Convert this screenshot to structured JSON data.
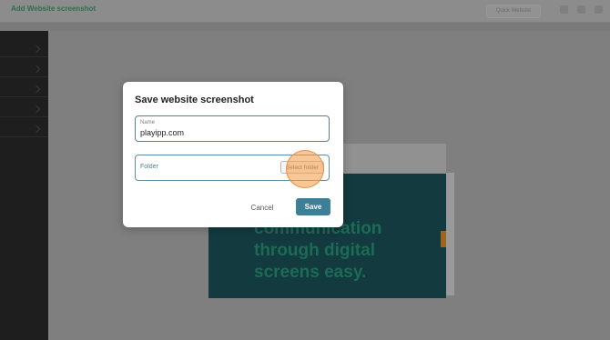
{
  "app": {
    "title": "Add Website screenshot",
    "top_button_label": "Quick Website"
  },
  "preview": {
    "headline": "...kes communication through digital screens easy."
  },
  "modal": {
    "title": "Save website screenshot",
    "name_label": "Name",
    "name_value": "playipp.com",
    "folder_label": "Folder",
    "select_folder_label": "Select folder",
    "cancel_label": "Cancel",
    "save_label": "Save"
  },
  "colors": {
    "accent": "#3d7e98",
    "click_highlight": "#f5a050",
    "overlay": "#7f7f7f"
  }
}
